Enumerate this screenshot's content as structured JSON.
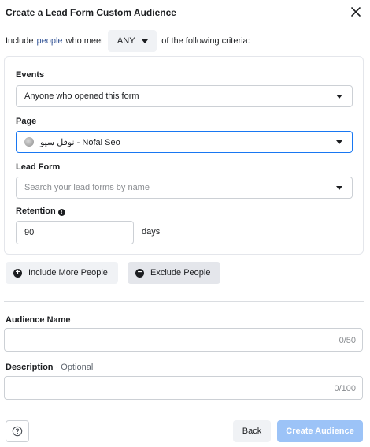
{
  "dialog": {
    "title": "Create a Lead Form Custom Audience"
  },
  "criteria_row": {
    "prefix": "Include",
    "link": "people",
    "middle": "who meet",
    "match_value": "ANY",
    "suffix": "of the following criteria:"
  },
  "events": {
    "label": "Events",
    "value": "Anyone who opened this form"
  },
  "page": {
    "label": "Page",
    "value": "نوفل سيو - Nofal Seo"
  },
  "lead_form": {
    "label": "Lead Form",
    "placeholder": "Search your lead forms by name"
  },
  "retention": {
    "label": "Retention",
    "value": "90",
    "unit": "days"
  },
  "buttons": {
    "include_more": "Include More People",
    "exclude": "Exclude People",
    "back": "Back",
    "create": "Create Audience"
  },
  "audience_name": {
    "label": "Audience Name",
    "counter": "0/50"
  },
  "description": {
    "label": "Description",
    "optional": "· Optional",
    "counter": "0/100"
  },
  "colors": {
    "accent": "#1877f2",
    "link": "#385898",
    "create_disabled": "#9cc3f7"
  }
}
